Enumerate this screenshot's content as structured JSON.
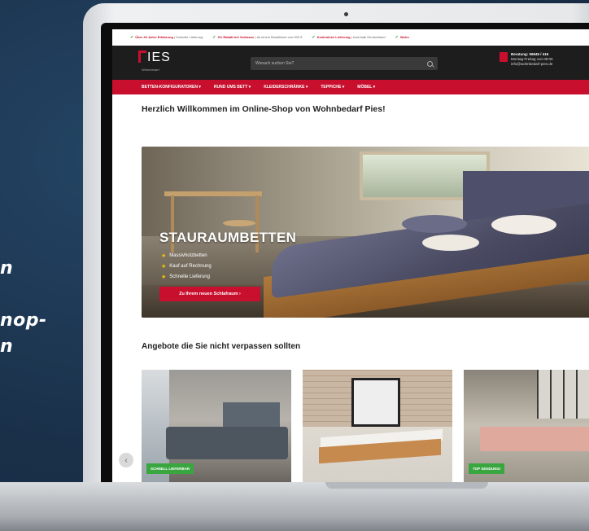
{
  "side_text": {
    "line1": "n",
    "line2": "nop-",
    "line3": "n"
  },
  "topbar": {
    "items": [
      {
        "bold": "Über 40 Jahre Erfahrung",
        "rest": "Schnelle Lieferung"
      },
      {
        "bold": "3% Rabatt bei Vorkasse",
        "rest": "ab einem Bestellwert von 500 €"
      },
      {
        "bold": "Kostenlose Lieferung",
        "rest": "innerhalb Deutschland"
      },
      {
        "bold": "Wohn",
        "rest": ""
      }
    ]
  },
  "header": {
    "logo": "IES",
    "logo_sub": "Wohnbedarf",
    "search_placeholder": "Wonach suchen Sie?",
    "contact": {
      "line1": "Beratung: 06945 / 416",
      "line2": "Montag-Freitag von 09:00",
      "line3": "info@wohnbedarf-pies.de"
    }
  },
  "nav": {
    "items": [
      "BETTEN-KONFIGURATOREN ▾",
      "RUND UMS BETT ▾",
      "KLEIDERSCHRÄNKE ▾",
      "TEPPICHE ▾",
      "MÖBEL ▾"
    ]
  },
  "main": {
    "welcome": "Herzlich Willkommen im Online-Shop von Wohnbedarf Pies!",
    "hero": {
      "title": "STAURAUMBETTEN",
      "features": [
        "Massivholzbetten",
        "Kauf auf Rechnung",
        "Schnelle Lieferung"
      ],
      "button": "Zu Ihrem neuen Schlafraum ›"
    },
    "offers_title": "Angebote die Sie nicht verpassen sollten",
    "products": [
      {
        "badge": "SCHNELL LIEFERBAR"
      },
      {
        "badge": ""
      },
      {
        "badge": "TOP SENDUNG!"
      }
    ]
  },
  "colors": {
    "brand_red": "#c8102e",
    "badge_green": "#3aa640",
    "header_dark": "#1d1d1d"
  }
}
